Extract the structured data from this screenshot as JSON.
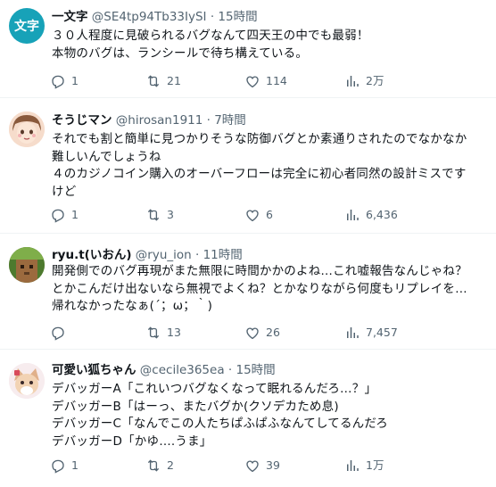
{
  "tweets": [
    {
      "name": "一文字",
      "handle": "@SE4tp94Tb33IySI",
      "time": "· 15時間",
      "avatar_text": "文字",
      "lines": [
        "３０人程度に見破られるバグなんて四天王の中でも最弱！",
        "本物のバグは、ランシールで待ち構えている。"
      ],
      "reply": "1",
      "retweet": "21",
      "like": "114",
      "views": "2万"
    },
    {
      "name": "そうじマン",
      "handle": "@hirosan1911",
      "time": "· 7時間",
      "lines": [
        "それでも割と簡単に見つかりそうな防御バグとか素通りされたのでなかなか",
        "難しいんでしょうね",
        "４のカジノコイン購入のオーバーフローは完全に初心者同然の設計ミスです",
        "けど"
      ],
      "reply": "1",
      "retweet": "3",
      "like": "6",
      "views": "6,436"
    },
    {
      "name": "ryu.t(いおん)",
      "handle": "@ryu_ion",
      "time": "· 11時間",
      "lines": [
        "開発側でのバグ再現がまた無限に時間かかのよね…これ嘘報告なんじゃね？",
        "とかこんだけ出ないなら無視でよくね？とかなりながら何度もリプレイを…",
        "帰れなかったなぁ(´；ω；｀)"
      ],
      "reply": "",
      "retweet": "13",
      "like": "26",
      "views": "7,457"
    },
    {
      "name": "可愛い狐ちゃん",
      "handle": "@cecile365ea",
      "time": "· 15時間",
      "lines": [
        "デバッガーA「これいつバグなくなって眠れるんだろ…？」",
        "デバッガーB「はーっ、またバグか(クソデカため息)",
        "デバッガーC「なんでこの人たちぱふぱふなんてしてるんだろ",
        "デバッガーD「かゆ….うま」"
      ],
      "reply": "1",
      "retweet": "2",
      "like": "39",
      "views": "1万"
    }
  ],
  "icons": {
    "reply": "reply-icon",
    "retweet": "retweet-icon",
    "like": "like-icon",
    "views": "views-icon"
  },
  "colors": {
    "text": "#0f1419",
    "secondary": "#536471",
    "avatar_teal": "#17a2b8",
    "divider": "#eff3f4"
  }
}
